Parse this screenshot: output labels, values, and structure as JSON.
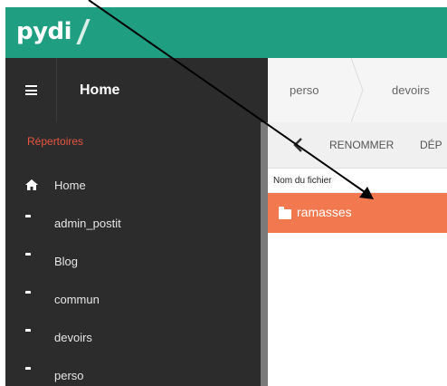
{
  "app": {
    "logo_text": "pydi"
  },
  "header": {
    "title": "Home"
  },
  "breadcrumb": {
    "items": [
      "perso",
      "devoirs"
    ]
  },
  "sidebar": {
    "heading": "Répertoires",
    "items": [
      {
        "label": "Home",
        "icon": "home-icon"
      },
      {
        "label": "admin_postit",
        "icon": "folder-icon"
      },
      {
        "label": "Blog",
        "icon": "folder-icon"
      },
      {
        "label": "commun",
        "icon": "folder-icon"
      },
      {
        "label": "devoirs",
        "icon": "folder-icon"
      },
      {
        "label": "perso",
        "icon": "folder-icon"
      }
    ]
  },
  "toolbar": {
    "rename_label": "RENOMMER",
    "move_label": "DÉP"
  },
  "file_list": {
    "column_name": "Nom du fichier",
    "rows": [
      {
        "name": "ramasses",
        "icon": "folder-icon",
        "selected": true
      }
    ]
  },
  "colors": {
    "brand": "#1f9e82",
    "sidebar_bg": "#2c2c2c",
    "accent_heading": "#e8543f",
    "selected_row": "#f2784f"
  }
}
